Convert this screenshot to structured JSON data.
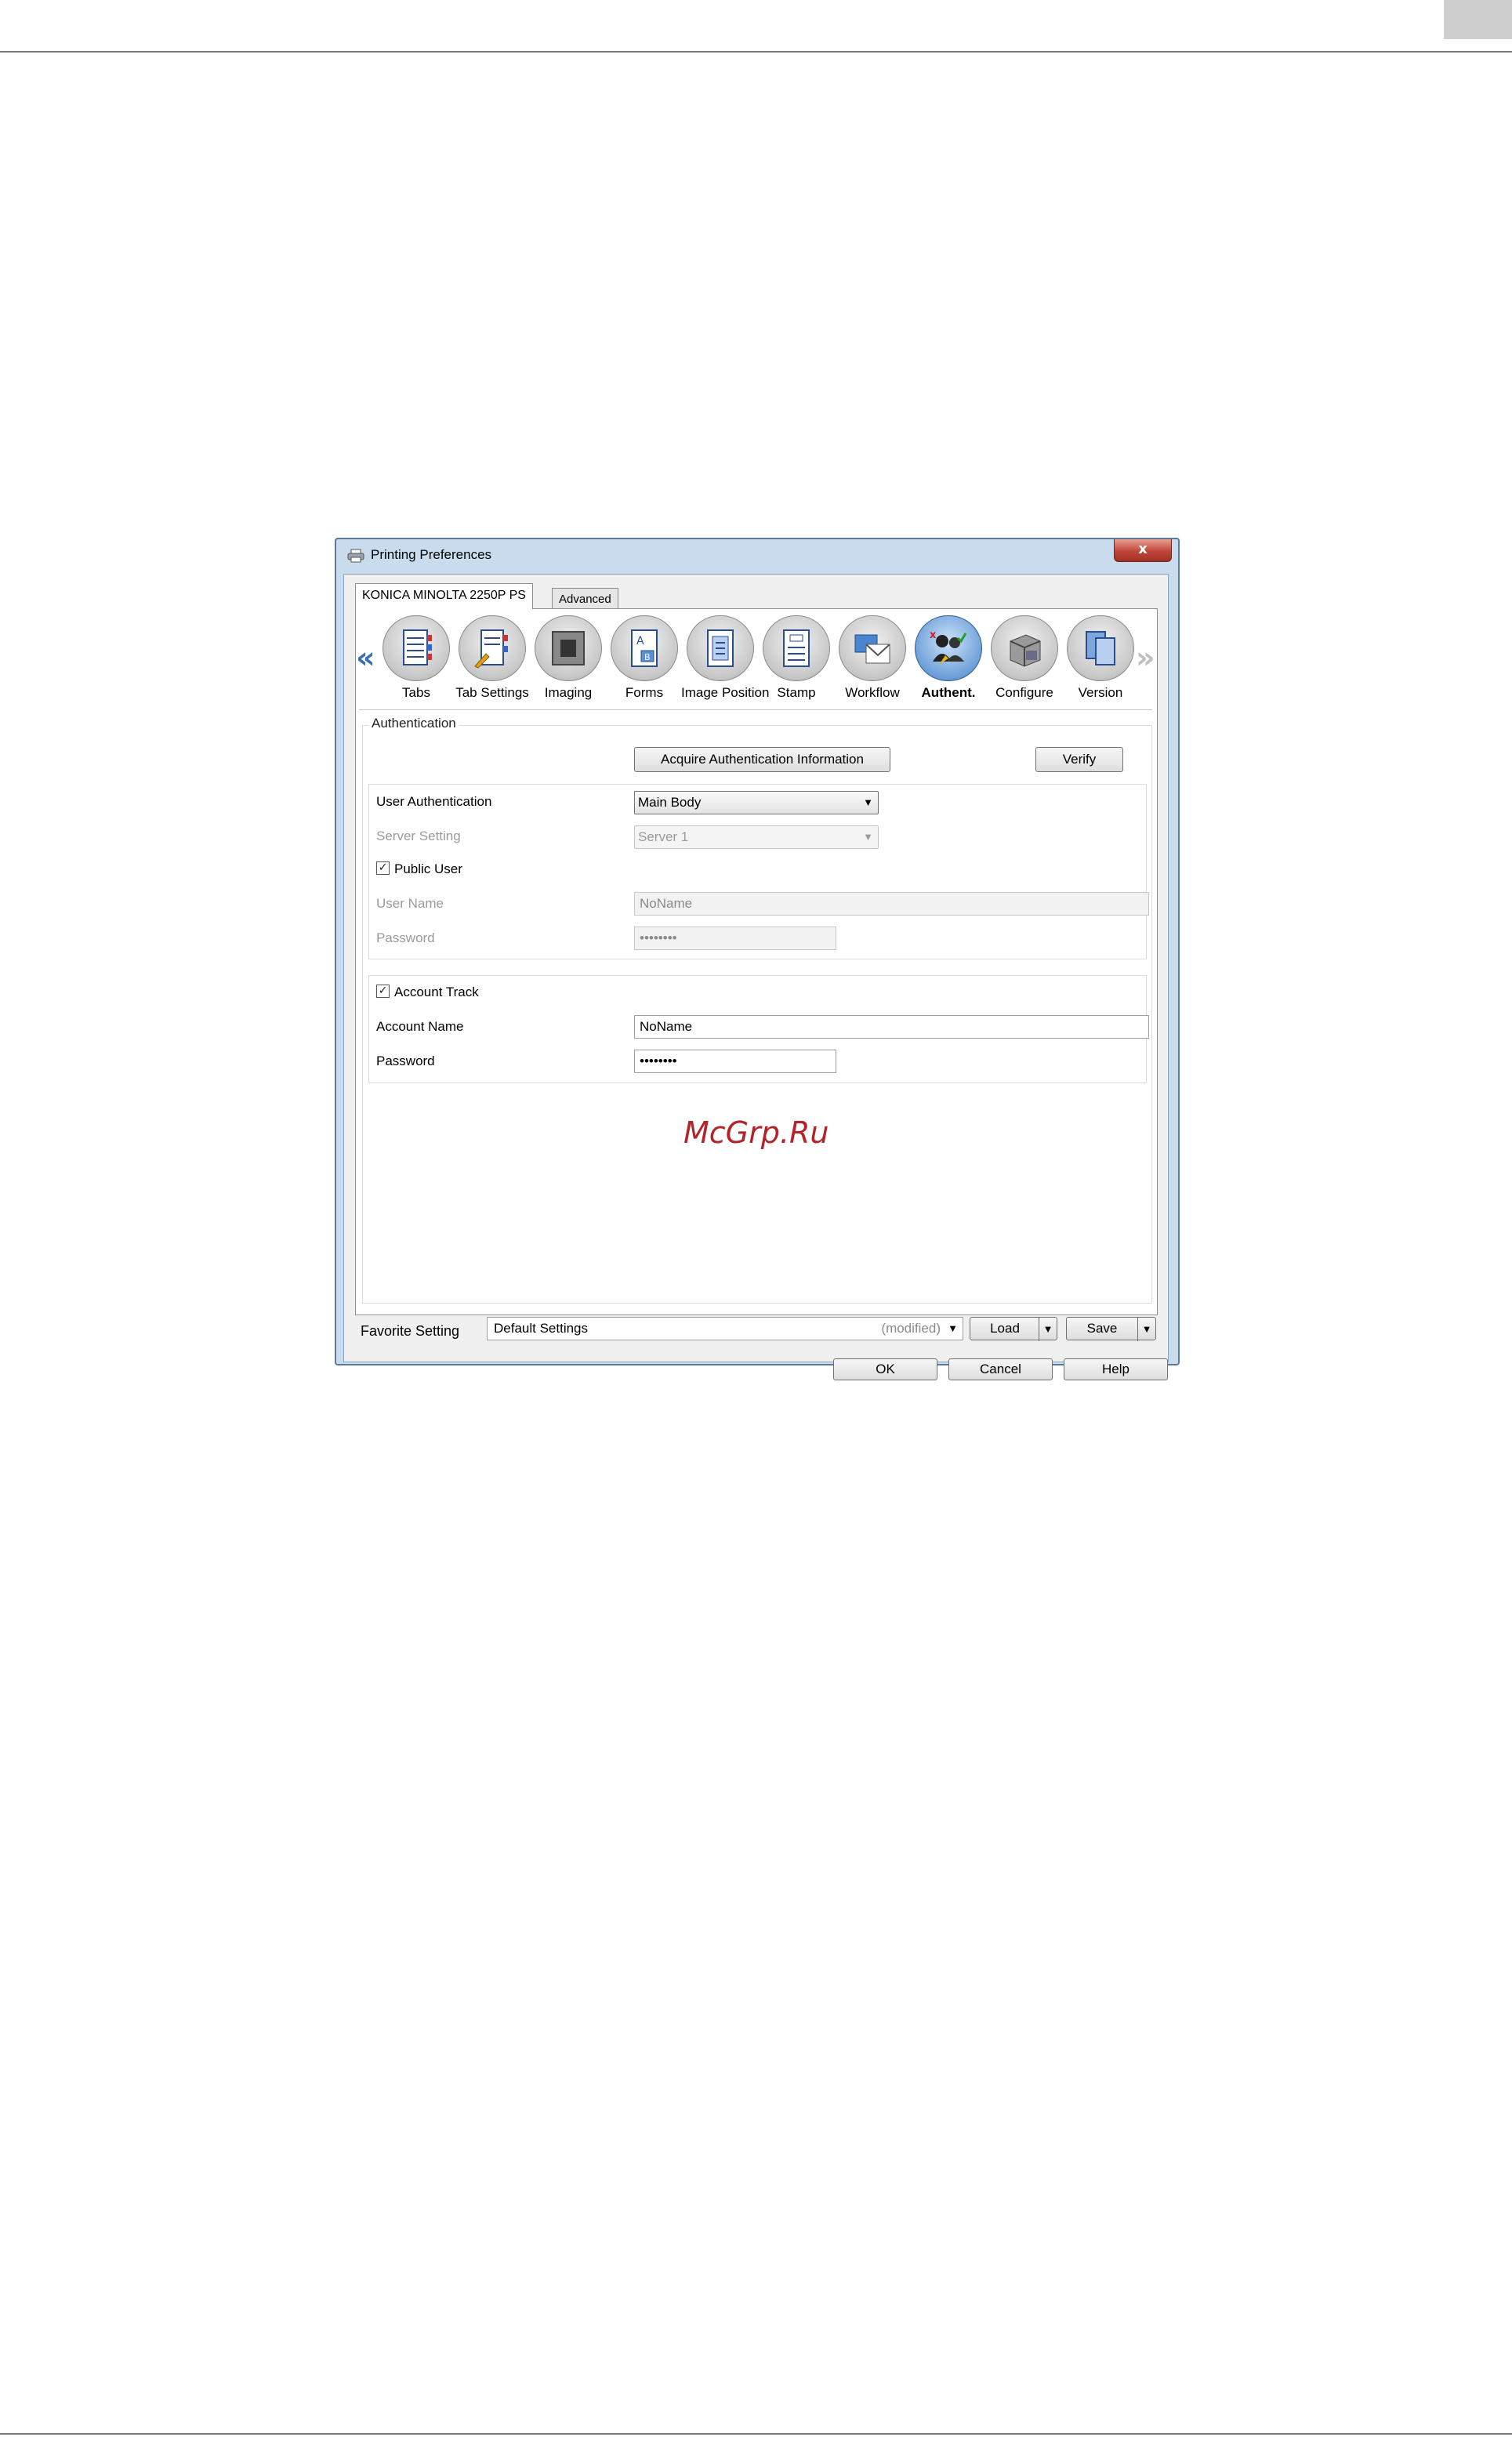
{
  "window": {
    "title": "Printing Preferences",
    "close_label": "x"
  },
  "tabs": {
    "main": "KONICA MINOLTA 2250P PS",
    "advanced": "Advanced"
  },
  "iconbar": {
    "left_arrow": "«",
    "right_arrow": "»",
    "items": [
      {
        "label": "Tabs",
        "icon": "tabs-icon"
      },
      {
        "label": "Tab Settings",
        "icon": "tab-settings-icon"
      },
      {
        "label": "Imaging",
        "icon": "imaging-icon"
      },
      {
        "label": "Forms",
        "icon": "forms-icon"
      },
      {
        "label": "Image Position",
        "icon": "image-position-icon"
      },
      {
        "label": "Stamp",
        "icon": "stamp-icon"
      },
      {
        "label": "Workflow",
        "icon": "workflow-icon"
      },
      {
        "label": "Authent.",
        "icon": "authentication-icon",
        "active": true
      },
      {
        "label": "Configure",
        "icon": "configure-icon"
      },
      {
        "label": "Version",
        "icon": "version-icon"
      }
    ]
  },
  "auth": {
    "group_title": "Authentication",
    "acquire_button": "Acquire Authentication Information",
    "verify_button": "Verify",
    "user_auth_label": "User Authentication",
    "user_auth_value": "Main Body",
    "server_setting_label": "Server Setting",
    "server_setting_value": "Server 1",
    "public_user_label": "Public User",
    "public_user_checked": true,
    "user_name_label": "User Name",
    "user_name_value": "NoName",
    "password_label": "Password",
    "password_value": "••••••••"
  },
  "account": {
    "track_label": "Account Track",
    "track_checked": true,
    "name_label": "Account Name",
    "name_value": "NoName",
    "password_label": "Password",
    "password_value": "••••••••"
  },
  "watermark": "McGrp.Ru",
  "favorite": {
    "label": "Favorite Setting",
    "value": "Default Settings",
    "modified": "(modified)",
    "load_button": "Load",
    "save_button": "Save"
  },
  "dialog_buttons": {
    "ok": "OK",
    "cancel": "Cancel",
    "help": "Help"
  },
  "colors": {
    "accent": "#3b6fb5",
    "watermark": "#b2232a"
  }
}
